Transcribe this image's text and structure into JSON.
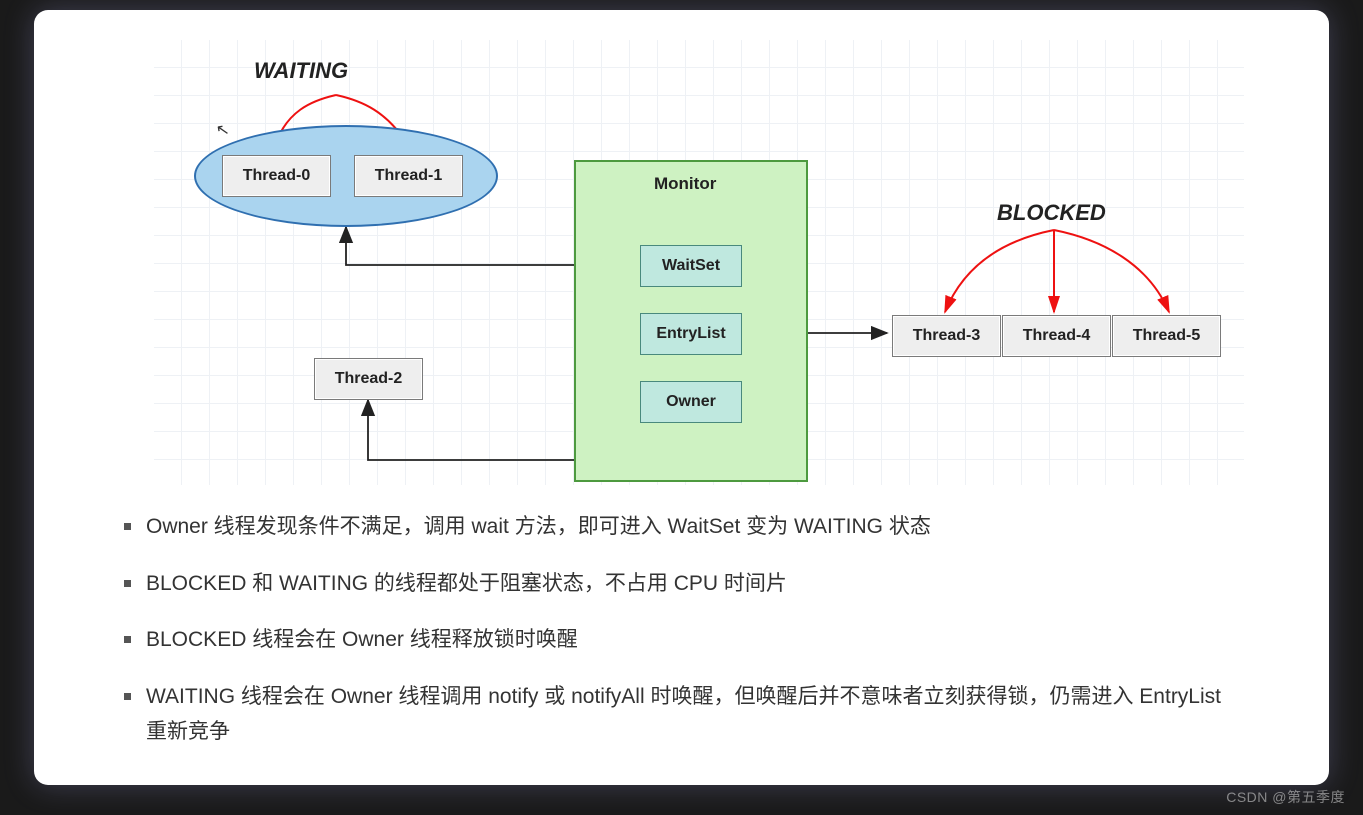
{
  "headers": {
    "waiting": "WAITING",
    "blocked": "BLOCKED",
    "monitor": "Monitor"
  },
  "threads": {
    "t0": "Thread-0",
    "t1": "Thread-1",
    "t2": "Thread-2",
    "t3": "Thread-3",
    "t4": "Thread-4",
    "t5": "Thread-5"
  },
  "monitor": {
    "waitset": "WaitSet",
    "entrylist": "EntryList",
    "owner": "Owner"
  },
  "bullets": {
    "b1": "Owner 线程发现条件不满足，调用 wait 方法，即可进入 WaitSet 变为 WAITING 状态",
    "b2": "BLOCKED 和 WAITING 的线程都处于阻塞状态，不占用 CPU 时间片",
    "b3": "BLOCKED 线程会在 Owner 线程释放锁时唤醒",
    "b4": "WAITING 线程会在 Owner 线程调用 notify 或 notifyAll 时唤醒，但唤醒后并不意味者立刻获得锁，仍需进入 EntryList 重新竞争"
  },
  "watermark": "CSDN @第五季度"
}
